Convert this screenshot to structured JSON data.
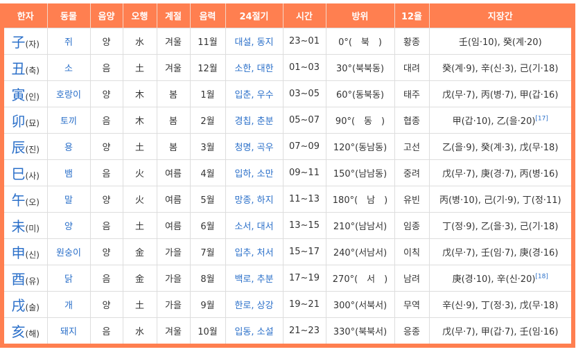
{
  "table": {
    "accent_color": "#ff7f50",
    "link_color": "#2a6fc9",
    "headers": [
      "한자",
      "동물",
      "음양",
      "오행",
      "계절",
      "음력",
      "24절기",
      "시간",
      "방위",
      "12율",
      "지장간"
    ],
    "rows": [
      {
        "hanja": "子",
        "reading": "(자)",
        "animal": "쥐",
        "yinyang": "양",
        "element": "水",
        "season": "겨울",
        "lunar": "11월",
        "solar_terms": "대설, 동지",
        "time": "23~01",
        "direction": "0°(　북　)",
        "pitch": "황종",
        "hidden_stems": "壬(임·10), 癸(계·20)",
        "ref": ""
      },
      {
        "hanja": "丑",
        "reading": "(축)",
        "animal": "소",
        "yinyang": "음",
        "element": "土",
        "season": "겨울",
        "lunar": "12월",
        "solar_terms": "소한, 대한",
        "time": "01~03",
        "direction": "30°(북북동)",
        "pitch": "대려",
        "hidden_stems": "癸(계·9), 辛(신·3), 己(기·18)",
        "ref": ""
      },
      {
        "hanja": "寅",
        "reading": "(인)",
        "animal": "호랑이",
        "yinyang": "양",
        "element": "木",
        "season": "봄",
        "lunar": "1월",
        "solar_terms": "입춘, 우수",
        "time": "03~05",
        "direction": "60°(동북동)",
        "pitch": "태주",
        "hidden_stems": "戊(무·7), 丙(병·7), 甲(갑·16)",
        "ref": ""
      },
      {
        "hanja": "卯",
        "reading": "(묘)",
        "animal": "토끼",
        "yinyang": "음",
        "element": "木",
        "season": "봄",
        "lunar": "2월",
        "solar_terms": "경칩, 춘분",
        "time": "05~07",
        "direction": "90°(　동　)",
        "pitch": "협종",
        "hidden_stems": "甲(갑·10), 乙(을·20)",
        "ref": "[17]"
      },
      {
        "hanja": "辰",
        "reading": "(진)",
        "animal": "용",
        "yinyang": "양",
        "element": "土",
        "season": "봄",
        "lunar": "3월",
        "solar_terms": "청명, 곡우",
        "time": "07~09",
        "direction": "120°(동남동)",
        "pitch": "고선",
        "hidden_stems": "乙(을·9), 癸(계·3), 戊(무·18)",
        "ref": ""
      },
      {
        "hanja": "巳",
        "reading": "(사)",
        "animal": "뱀",
        "yinyang": "음",
        "element": "火",
        "season": "여름",
        "lunar": "4월",
        "solar_terms": "입하, 소만",
        "time": "09~11",
        "direction": "150°(남남동)",
        "pitch": "중려",
        "hidden_stems": "戊(무·7), 庚(경·7), 丙(병·16)",
        "ref": ""
      },
      {
        "hanja": "午",
        "reading": "(오)",
        "animal": "말",
        "yinyang": "양",
        "element": "火",
        "season": "여름",
        "lunar": "5월",
        "solar_terms": "망종, 하지",
        "time": "11~13",
        "direction": "180°(　남　)",
        "pitch": "유빈",
        "hidden_stems": "丙(병·10), 己(기·9), 丁(정·11)",
        "ref": ""
      },
      {
        "hanja": "未",
        "reading": "(미)",
        "animal": "양",
        "yinyang": "음",
        "element": "土",
        "season": "여름",
        "lunar": "6월",
        "solar_terms": "소서, 대서",
        "time": "13~15",
        "direction": "210°(남남서)",
        "pitch": "임종",
        "hidden_stems": "丁(정·9), 乙(을·3), 己(기·18)",
        "ref": ""
      },
      {
        "hanja": "申",
        "reading": "(신)",
        "animal": "원숭이",
        "yinyang": "양",
        "element": "金",
        "season": "가을",
        "lunar": "7월",
        "solar_terms": "입추, 처서",
        "time": "15~17",
        "direction": "240°(서남서)",
        "pitch": "이칙",
        "hidden_stems": "戊(무·7), 壬(임·7), 庚(경·16)",
        "ref": ""
      },
      {
        "hanja": "酉",
        "reading": "(유)",
        "animal": "닭",
        "yinyang": "음",
        "element": "金",
        "season": "가을",
        "lunar": "8월",
        "solar_terms": "백로, 추분",
        "time": "17~19",
        "direction": "270°(　서　)",
        "pitch": "남려",
        "hidden_stems": "庚(경·10), 辛(신·20)",
        "ref": "[18]"
      },
      {
        "hanja": "戌",
        "reading": "(술)",
        "animal": "개",
        "yinyang": "양",
        "element": "土",
        "season": "가을",
        "lunar": "9월",
        "solar_terms": "한로, 상강",
        "time": "19~21",
        "direction": "300°(서북서)",
        "pitch": "무역",
        "hidden_stems": "辛(신·9), 丁(정·3), 戊(무·18)",
        "ref": ""
      },
      {
        "hanja": "亥",
        "reading": "(해)",
        "animal": "돼지",
        "yinyang": "음",
        "element": "水",
        "season": "겨울",
        "lunar": "10월",
        "solar_terms": "입동, 소설",
        "time": "21~23",
        "direction": "330°(북북서)",
        "pitch": "응종",
        "hidden_stems": "戊(무·7), 甲(갑·7), 壬(임·16)",
        "ref": ""
      }
    ]
  }
}
